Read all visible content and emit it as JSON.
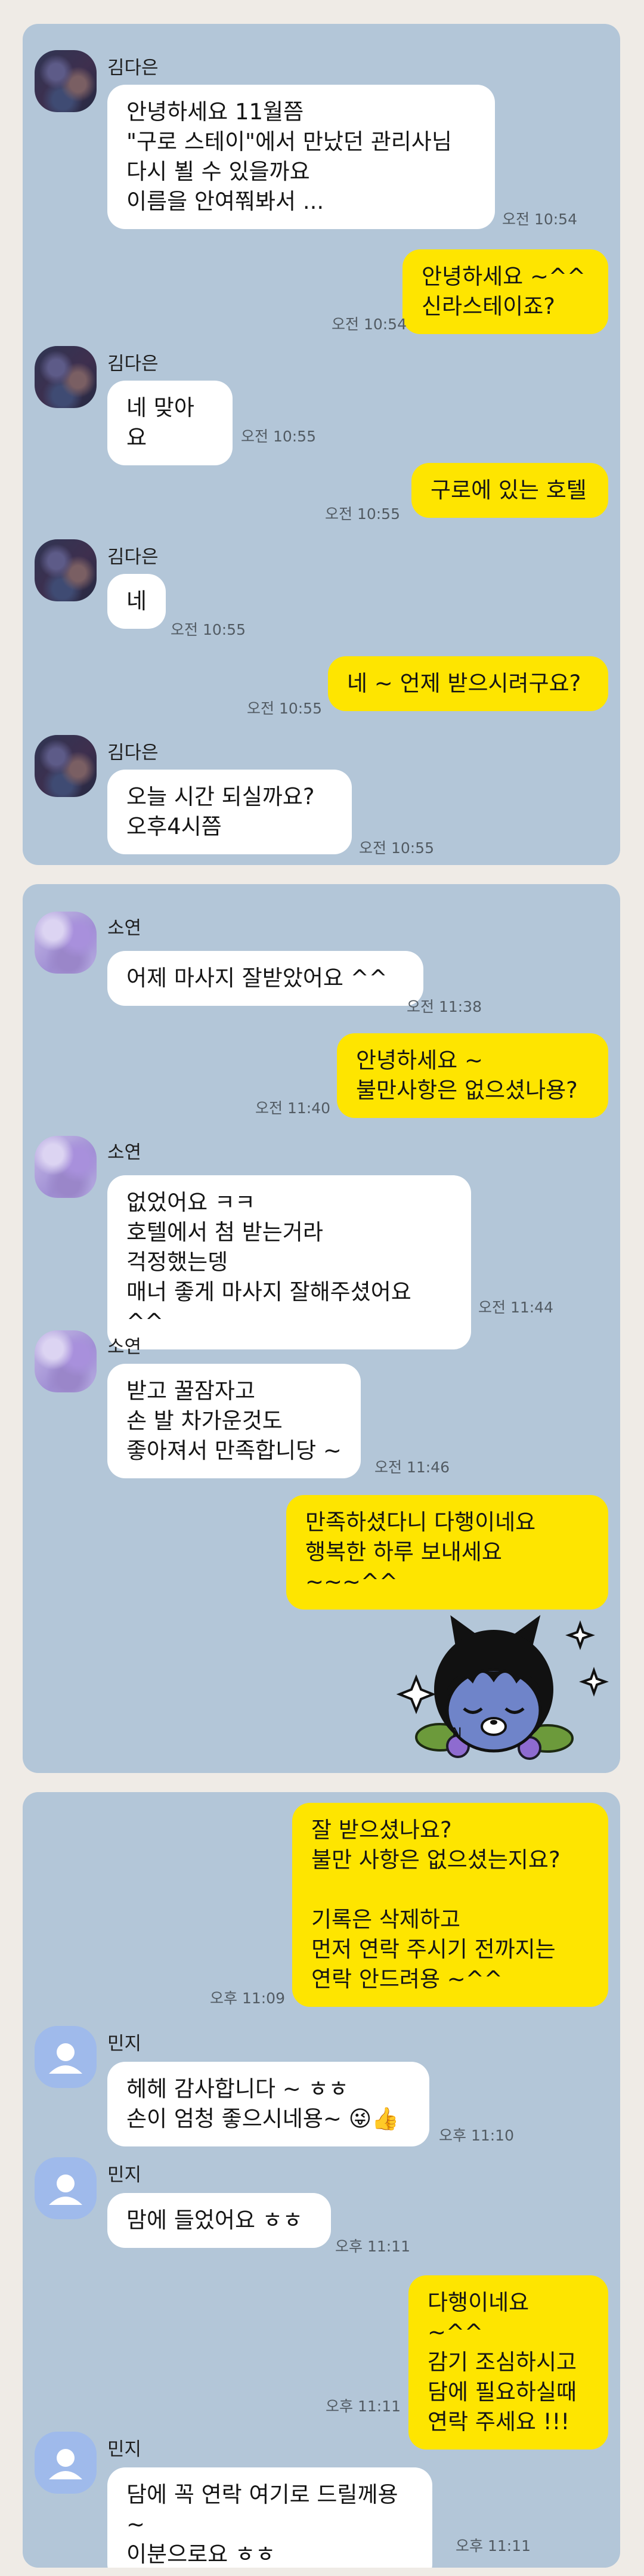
{
  "colors": {
    "page_background": "#efebe6",
    "chat_background": "#b3c6d8",
    "incoming_bubble": "#ffffff",
    "outgoing_bubble": "#fee500"
  },
  "chat1": {
    "sender": "김다은",
    "messages": [
      {
        "text": "안녕하세요 11월쯤\n\"구로 스테이\"에서 만났던 관리사님\n다시 뵐 수 있을까요\n이름을 안여쭤봐서 ...",
        "time": "오전 10:54"
      },
      {
        "text": "안녕하세요 ~^^\n신라스테이죠?",
        "time": "오전 10:54"
      },
      {
        "text": "네 맞아요",
        "time": "오전 10:55"
      },
      {
        "text": "구로에 있는 호텔",
        "time": "오전 10:55"
      },
      {
        "text": "네",
        "time": "오전 10:55"
      },
      {
        "text": "네 ~ 언제 받으시려구요?",
        "time": "오전 10:55"
      },
      {
        "text": "오늘  시간 되실까요?\n오후4시쯤",
        "time": "오전 10:55"
      }
    ]
  },
  "chat2": {
    "sender": "소연",
    "messages": [
      {
        "text": "어제 마사지 잘받았어요 ^^",
        "time": "오전 11:38"
      },
      {
        "text": "안녕하세요 ~\n불만사항은 없으셨나용?",
        "time": "오전 11:40"
      },
      {
        "text": "없었어요 ㅋㅋ\n호텔에서 첨 받는거라\n걱정했는뎅\n매너 좋게 마사지 잘해주셨어요 ^^",
        "time": "오전 11:44"
      },
      {
        "text": "받고 꿀잠자고\n손 발 차가운것도\n좋아져서 만족합니당 ~",
        "time": "오전 11:46"
      },
      {
        "text": "만족하셨다니 다행이네요\n행복한 하루 보내세요 ~~~^^",
        "time": ""
      }
    ],
    "sticker": "kakao-character-sticker"
  },
  "chat3": {
    "sender": "민지",
    "messages": [
      {
        "text": "잘 받으셨나요?\n불만 사항은 없으셨는지요?\n\n기록은 삭제하고\n먼저 연락 주시기 전까지는\n연락 안드려용 ~^^",
        "time": "오후 11:09"
      },
      {
        "text": "헤헤 감사합니다 ~ ㅎㅎ\n손이 엄청 좋으시네용~ 😜👍",
        "time": "오후 11:10"
      },
      {
        "text": "맘에 들었어요 ㅎㅎ",
        "time": "오후 11:11"
      },
      {
        "text": "다행이네요 ~^^\n감기 조심하시고\n담에 필요하실때\n연락 주세요 !!!",
        "time": "오후 11:11"
      },
      {
        "text": "담에 꼭 연락 여기로 드릴께용~\n이분으로요 ㅎㅎ",
        "time": "오후 11:11"
      }
    ]
  }
}
